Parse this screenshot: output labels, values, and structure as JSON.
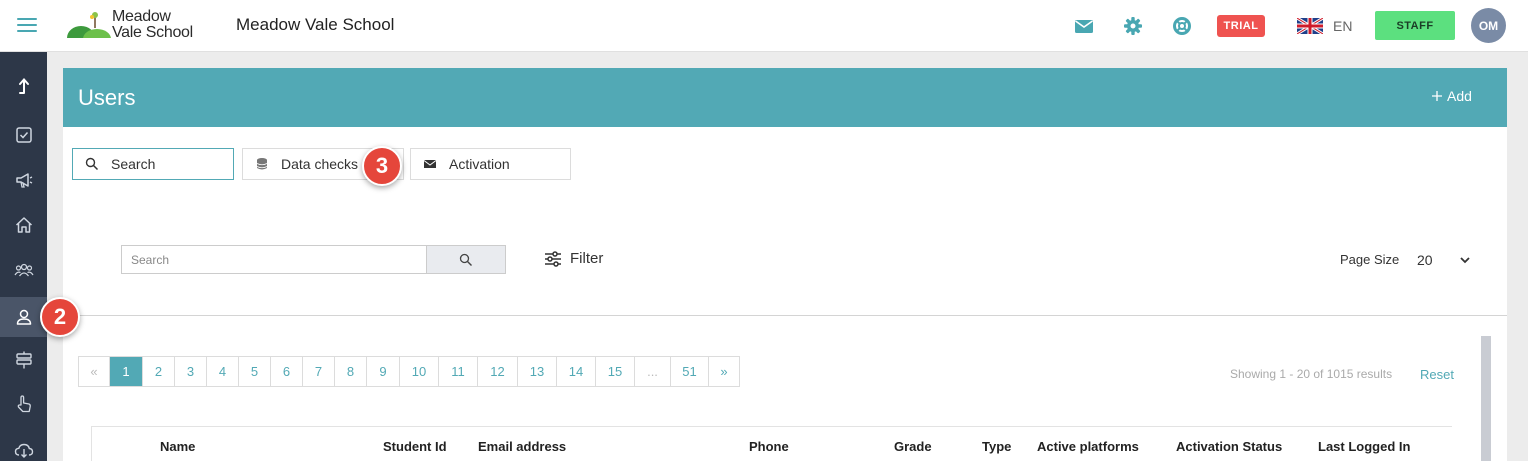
{
  "header": {
    "logo_line1": "Meadow",
    "logo_line2": "Vale School",
    "school_name": "Meadow Vale School",
    "icons": [
      "envelope-icon",
      "gear-icon",
      "lifebuoy-icon"
    ],
    "trial_badge": "TRIAL",
    "language": "EN",
    "role_button": "STAFF",
    "avatar_initials": "OM",
    "accent_color": "#49a7b2"
  },
  "sidebar": {
    "items": [
      {
        "name": "upload-icon"
      },
      {
        "name": "checkbox-icon"
      },
      {
        "name": "megaphone-icon"
      },
      {
        "name": "home-icon"
      },
      {
        "name": "users-group-icon"
      },
      {
        "name": "user-icon",
        "active": true
      },
      {
        "name": "signpost-icon"
      },
      {
        "name": "hand-pointer-icon"
      },
      {
        "name": "cloud-download-icon"
      }
    ]
  },
  "annotations": {
    "badge_sidebar": "2",
    "badge_tab": "3",
    "badge_color": "#e5463b"
  },
  "page": {
    "title": "Users",
    "add_label": "Add",
    "header_color": "#52a9b5"
  },
  "tabs": [
    {
      "label": "Search",
      "icon": "search-icon",
      "active": true
    },
    {
      "label": "Data checks",
      "icon": "database-icon",
      "active": false
    },
    {
      "label": "Activation",
      "icon": "envelope-icon",
      "active": false
    }
  ],
  "toolbar": {
    "search_placeholder": "Search",
    "filter_label": "Filter",
    "page_size_label": "Page Size",
    "page_size_value": "20"
  },
  "pagination": {
    "prev": "«",
    "pages": [
      "1",
      "2",
      "3",
      "4",
      "5",
      "6",
      "7",
      "8",
      "9",
      "10",
      "11",
      "12",
      "13",
      "14",
      "15",
      "...",
      "51"
    ],
    "next": "»",
    "current": "1"
  },
  "results": {
    "showing_text": "Showing 1 - 20 of 1015 results",
    "reset_label": "Reset"
  },
  "table": {
    "columns": [
      "Name",
      "Student Id",
      "Email address",
      "Phone",
      "Grade",
      "Type",
      "Active platforms",
      "Activation Status",
      "Last Logged In"
    ]
  }
}
